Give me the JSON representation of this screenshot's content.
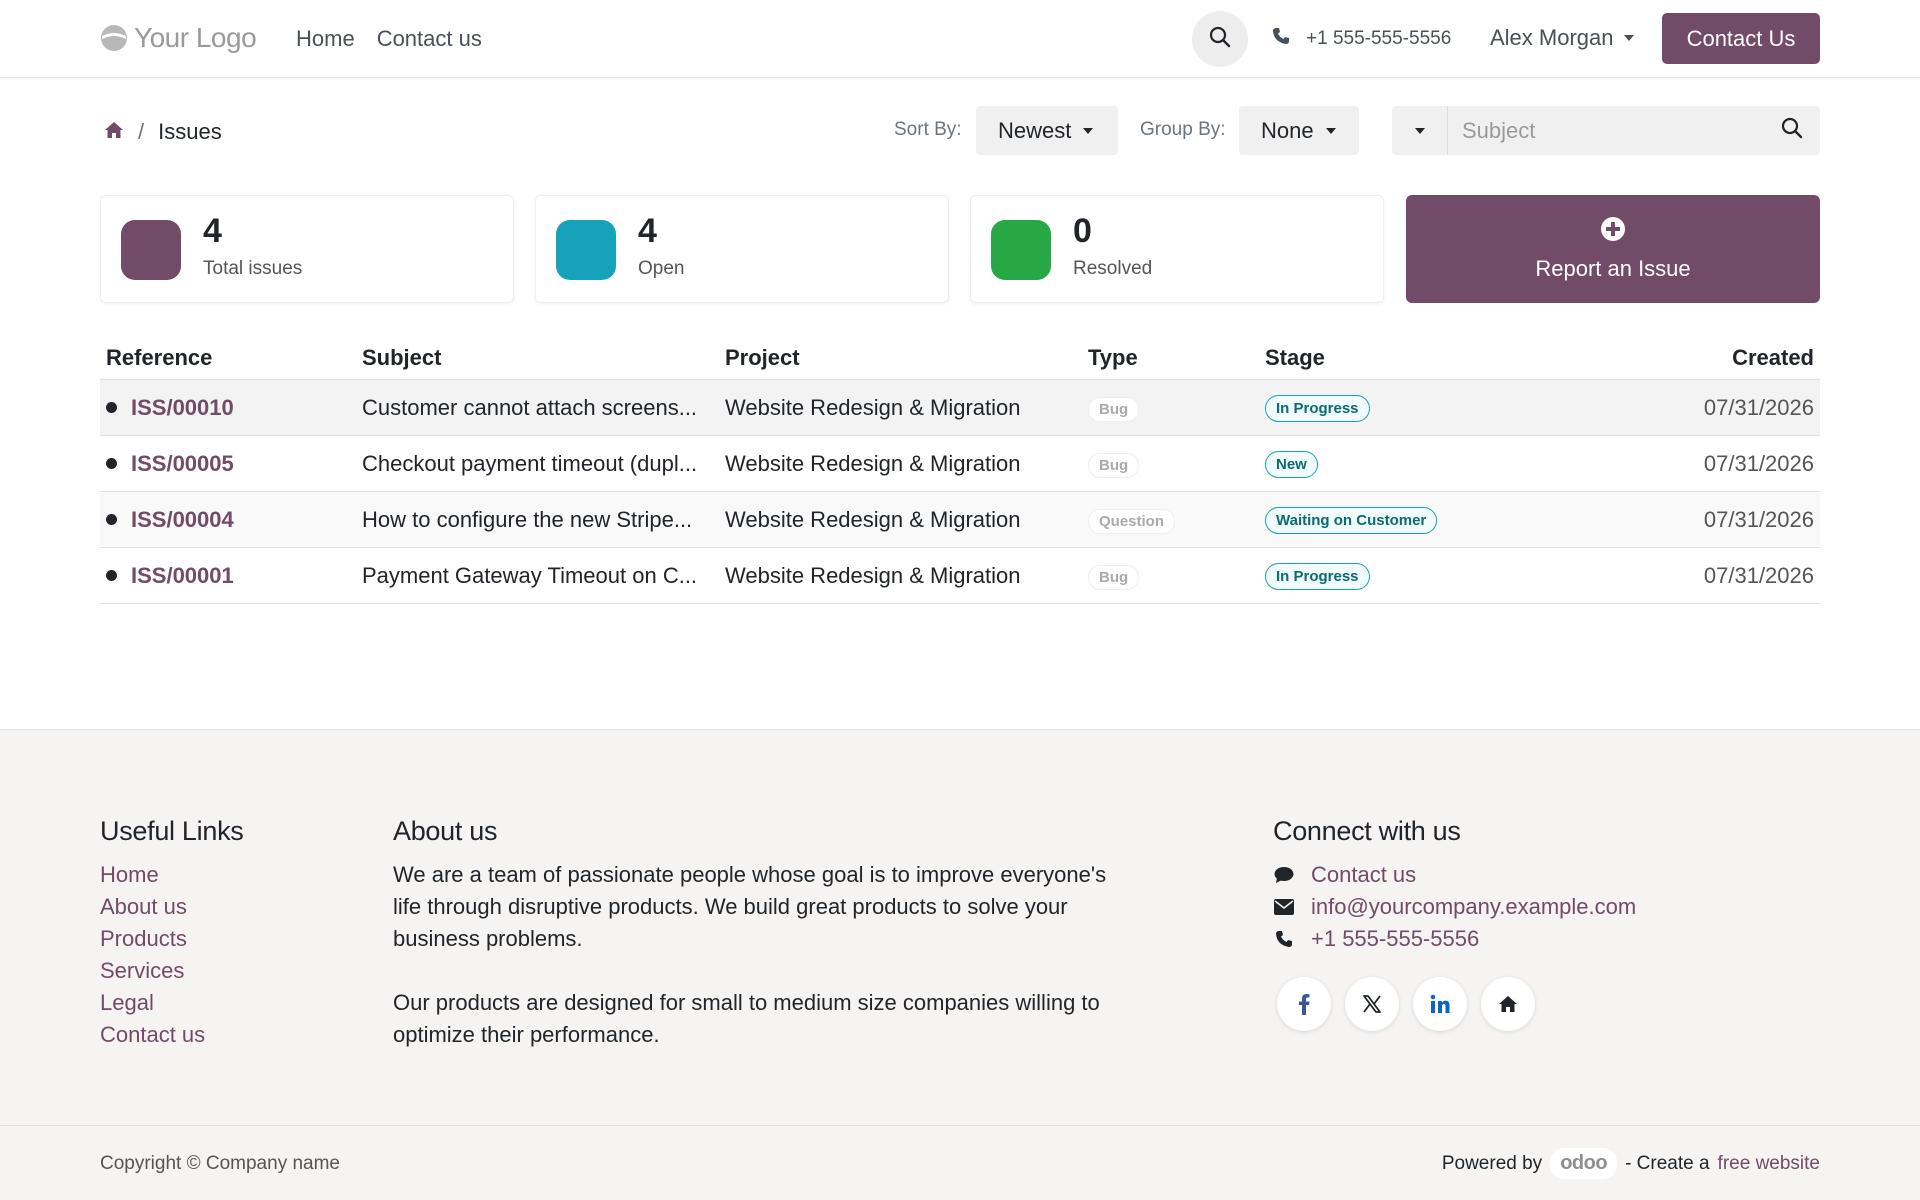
{
  "header": {
    "logo_text": "Your Logo",
    "nav": [
      "Home",
      "Contact us"
    ],
    "phone": "+1 555-555-5556",
    "user": "Alex Morgan",
    "cta": "Contact Us"
  },
  "toolbar": {
    "breadcrumb_current": "Issues",
    "breadcrumb_sep": "/",
    "sort_label": "Sort By:",
    "sort_value": "Newest",
    "group_label": "Group By:",
    "group_value": "None",
    "search_placeholder": "Subject"
  },
  "stats": [
    {
      "value": "4",
      "label": "Total issues",
      "color": "#714b67"
    },
    {
      "value": "4",
      "label": "Open",
      "color": "#17a2bb"
    },
    {
      "value": "0",
      "label": "Resolved",
      "color": "#28a745"
    }
  ],
  "report_button": "Report an Issue",
  "table": {
    "headers": [
      "Reference",
      "Subject",
      "Project",
      "Type",
      "Stage",
      "Created"
    ],
    "rows": [
      {
        "ref": "ISS/00010",
        "subject": "Customer cannot attach screens...",
        "project": "Website Redesign & Migration",
        "type": "Bug",
        "stage": "In Progress",
        "created": "07/31/2026"
      },
      {
        "ref": "ISS/00005",
        "subject": "Checkout payment timeout (dupl...",
        "project": "Website Redesign & Migration",
        "type": "Bug",
        "stage": "New",
        "created": "07/31/2026"
      },
      {
        "ref": "ISS/00004",
        "subject": "How to configure the new Stripe...",
        "project": "Website Redesign & Migration",
        "type": "Question",
        "stage": "Waiting on Customer",
        "created": "07/31/2026"
      },
      {
        "ref": "ISS/00001",
        "subject": "Payment Gateway Timeout on C...",
        "project": "Website Redesign & Migration",
        "type": "Bug",
        "stage": "In Progress",
        "created": "07/31/2026"
      }
    ]
  },
  "footer": {
    "links_title": "Useful Links",
    "links": [
      "Home",
      "About us",
      "Products",
      "Services",
      "Legal",
      "Contact us"
    ],
    "about_title": "About us",
    "about_p1": "We are a team of passionate people whose goal is to improve everyone's life through disruptive products. We build great products to solve your business problems.",
    "about_p2": "Our products are designed for small to medium size companies willing to optimize their performance.",
    "connect_title": "Connect with us",
    "connect": {
      "contact": "Contact us",
      "email": "info@yourcompany.example.com",
      "phone": "+1 555-555-5556"
    },
    "socials": [
      "facebook-icon",
      "x-icon",
      "linkedin-icon",
      "home-icon"
    ],
    "copyright": "Copyright © Company name",
    "powered_by": "Powered by",
    "powered_brand": "odoo",
    "create_a": "- Create a",
    "free_website": "free website"
  },
  "colors": {
    "accent": "#714b67",
    "info": "#17a2bb",
    "success": "#28a745"
  }
}
